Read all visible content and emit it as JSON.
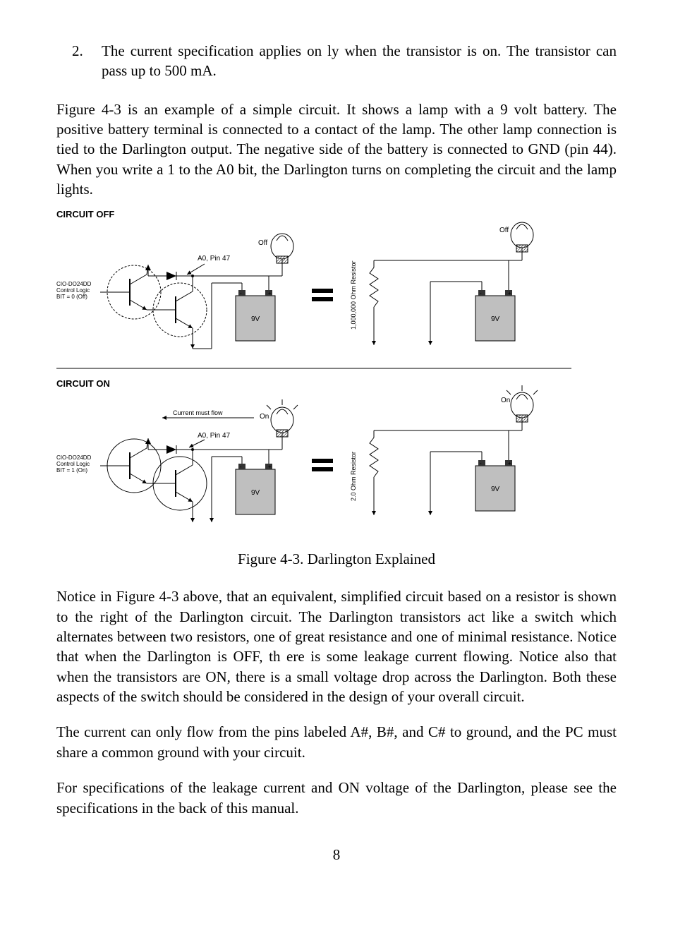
{
  "list": {
    "num": "2.",
    "text": "The current specification applies on ly when the transistor is on. The transistor can pass up to 500 mA."
  },
  "para1": "Figure 4-3 is an example of a simple circuit.  It shows a lamp with a 9 volt battery.  The positive battery terminal is connected to a contact of the lamp. The other lamp connection is tied to the Darlington output. The negative side of the battery is connected to GND (pin 44).  When you write a 1 to the A0 bit, the Darlington turns on completing the circuit and the lamp lights.",
  "fig": {
    "title_off": "CIRCUIT OFF",
    "title_on": "CIRCUIT ON",
    "pin_label": "A0, Pin 47",
    "logic_off_l1": "CIO-DO24DD",
    "logic_off_l2": "Control Logic",
    "logic_off_l3": "BIT = 0 (Off)",
    "logic_on_l1": "CIO-DO24DD",
    "logic_on_l2": "Control Logic",
    "logic_on_l3": "BIT = 1 (On)",
    "lamp_off": "Off",
    "lamp_on": "On",
    "battery_v": "9V",
    "current_flow": "Current must flow",
    "res_off": "1,000,000 Ohm Resistor",
    "res_on": "2.0 Ohm Resistor",
    "caption": "Figure 4-3. Darlington Explained"
  },
  "para2": "Notice in Figure 4-3 above, that an equivalent, simplified circuit based on a resistor is shown to the right of the Darlington circuit.   The Darlington transistors act like a switch which alternates between two resistors, one of great resistance and one of minimal resistance.  Notice that when the Darlington is OFF, th ere is some leakage current flowing.  Notice also that when the transistors are ON, there is a small voltage drop across the Darlington.  Both these aspects of the switch should be considered in the design of your overall circuit.",
  "para3": "The current can only flow from the pins labeled A#, B#, and C# to ground, and the PC must share a common ground with your circuit.",
  "para4": "For specifications of the leakage current and ON voltage of the Darlington, please see the specifications in the back of this manual.",
  "pagenum": "8"
}
